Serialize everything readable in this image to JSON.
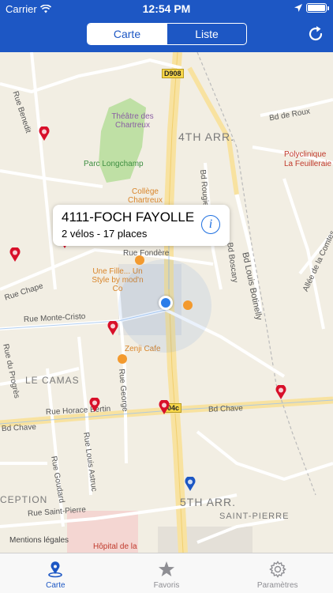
{
  "status": {
    "carrier": "Carrier",
    "time": "12:54 PM"
  },
  "header": {
    "tabs": [
      {
        "label": "Carte",
        "active": true
      },
      {
        "label": "Liste",
        "active": false
      }
    ],
    "refresh_icon": "refresh-icon"
  },
  "map": {
    "districts": [
      "4TH ARR.",
      "5TH ARR.",
      "LE CAMAS",
      "SAINT-PIERRE",
      "CEPTION"
    ],
    "roads": {
      "d908": "D908",
      "r04c": "04c",
      "rue_fondere": "Rue Fondère",
      "rue_monte_cristo": "Rue Monte-Cristo",
      "rue_chape": "Rue Chape",
      "rue_horace": "Rue Horace Bertin",
      "bd_chave": "Bd Chave",
      "rue_saint_pierre": "Rue Saint-Pierre",
      "bd_de_roux": "Bd de Roux",
      "bd_louis_botinelly": "Bd Louis Botinelly",
      "bd_boscary": "Bd Boscary",
      "rue_george": "Rue George",
      "rue_goudard": "Rue Goudard",
      "rue_louis_astruc": "Rue Louis Astruc",
      "rue_benedit": "Rue Benedit",
      "bd_rougier": "Bd Rougier",
      "allee_comtes": "Allée de la Comtes",
      "rue_progres": "Rue du Progrès",
      "rue_bretagne": "Rue Brets",
      "sagne": "Sagne",
      "bet": "bet"
    },
    "pois": {
      "theatre": "Théâtre des Chartreux",
      "parc": "Parc Longchamp",
      "college": "Collège Chartreux",
      "polyclinique": "Polyclinique La Feuilleraie",
      "une_fille": "Une Fille... Un Style by mod'n Co",
      "zenji": "Zenji Cafe",
      "hopital": "Hôpital de la"
    },
    "callout": {
      "title": "4111-FOCH FAYOLLE",
      "subtitle": "2 vélos - 17 places",
      "info_icon": "info-icon"
    },
    "legal": "Mentions légales",
    "colors": {
      "header": "#1d57c4",
      "pin_red": "#d8102a",
      "pin_blue": "#1d57c4",
      "user_dot": "#2b7de9"
    }
  },
  "tabbar": {
    "items": [
      {
        "label": "Carte",
        "icon": "map-pin-icon",
        "active": true
      },
      {
        "label": "Favoris",
        "icon": "star-icon",
        "active": false
      },
      {
        "label": "Paramètres",
        "icon": "gear-icon",
        "active": false
      }
    ]
  }
}
